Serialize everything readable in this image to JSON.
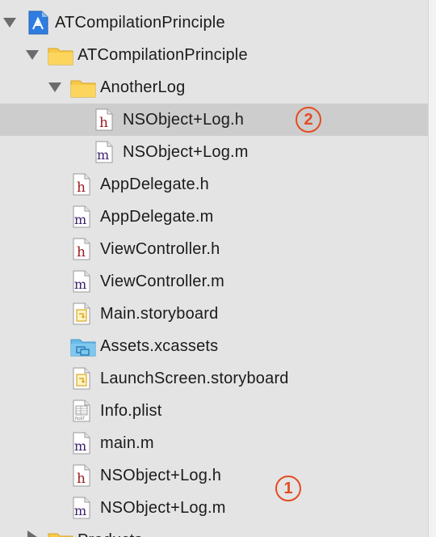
{
  "project": {
    "label": "ATCompilationPrinciple"
  },
  "group": {
    "label": "ATCompilationPrinciple"
  },
  "subgroup": {
    "label": "AnotherLog"
  },
  "files": {
    "nsobject_log_h_inner": "NSObject+Log.h",
    "nsobject_log_m_inner": "NSObject+Log.m",
    "appdelegate_h": "AppDelegate.h",
    "appdelegate_m": "AppDelegate.m",
    "viewcontroller_h": "ViewController.h",
    "viewcontroller_m": "ViewController.m",
    "main_storyboard": "Main.storyboard",
    "assets": "Assets.xcassets",
    "launchscreen": "LaunchScreen.storyboard",
    "info_plist": "Info.plist",
    "main_m": "main.m",
    "nsobject_log_h_outer": "NSObject+Log.h",
    "nsobject_log_m_outer": "NSObject+Log.m"
  },
  "products": {
    "label": "Products"
  },
  "icon_letters": {
    "header": "h",
    "impl": "m",
    "plist": "PLIST"
  },
  "annotations": {
    "badge_1": "1",
    "badge_2": "2"
  },
  "colors": {
    "header_letter": "#9b1c22",
    "impl_letter": "#3b1f6e",
    "folder": "#f7c948",
    "assets_folder": "#6bbbe8",
    "badge": "#e34b22",
    "selection": "#cdcdcd"
  },
  "selected_item": "NSObject+Log.h"
}
